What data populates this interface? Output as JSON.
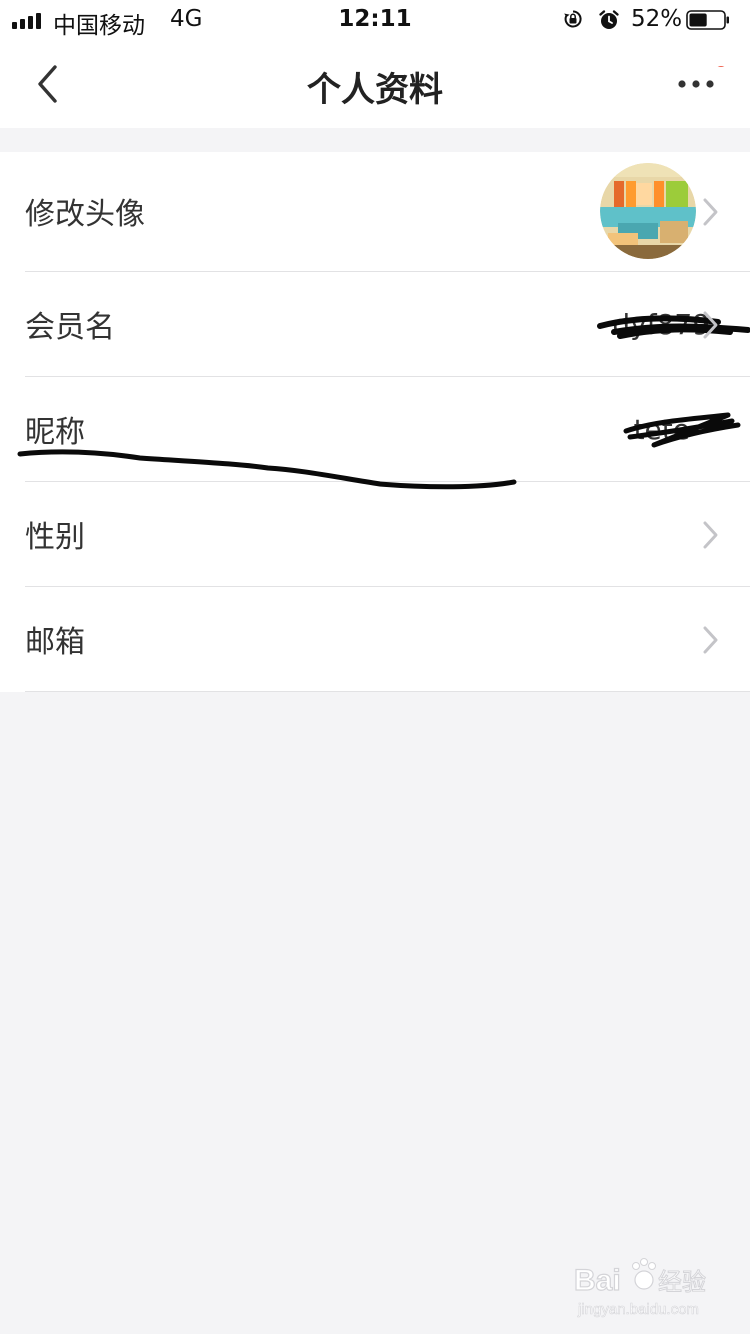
{
  "status_bar": {
    "carrier": "中国移动",
    "network": "4G",
    "time": "12:11",
    "battery_percent": "52%",
    "battery_level": 0.52,
    "icons": [
      "signal-icon",
      "rotation-lock-icon",
      "alarm-icon",
      "battery-icon"
    ]
  },
  "nav": {
    "title": "个人资料",
    "back_icon": "chevron-left-icon",
    "more_icon": "more-dots-icon",
    "notification_dot_color": "#f0604c"
  },
  "rows": [
    {
      "label": "修改头像"
    },
    {
      "label": "会员名",
      "value": "dyf879"
    },
    {
      "label": "昵称",
      "value": "tete"
    },
    {
      "label": "性别"
    },
    {
      "label": "邮箱"
    }
  ],
  "watermark": {
    "brand": "Bai",
    "brand_cn": "经验",
    "url": "jingyan.baidu.com"
  },
  "colors": {
    "background": "#f4f4f6",
    "surface": "#ffffff",
    "divider": "#e2e2e4",
    "chevron": "#c4c4c8"
  }
}
